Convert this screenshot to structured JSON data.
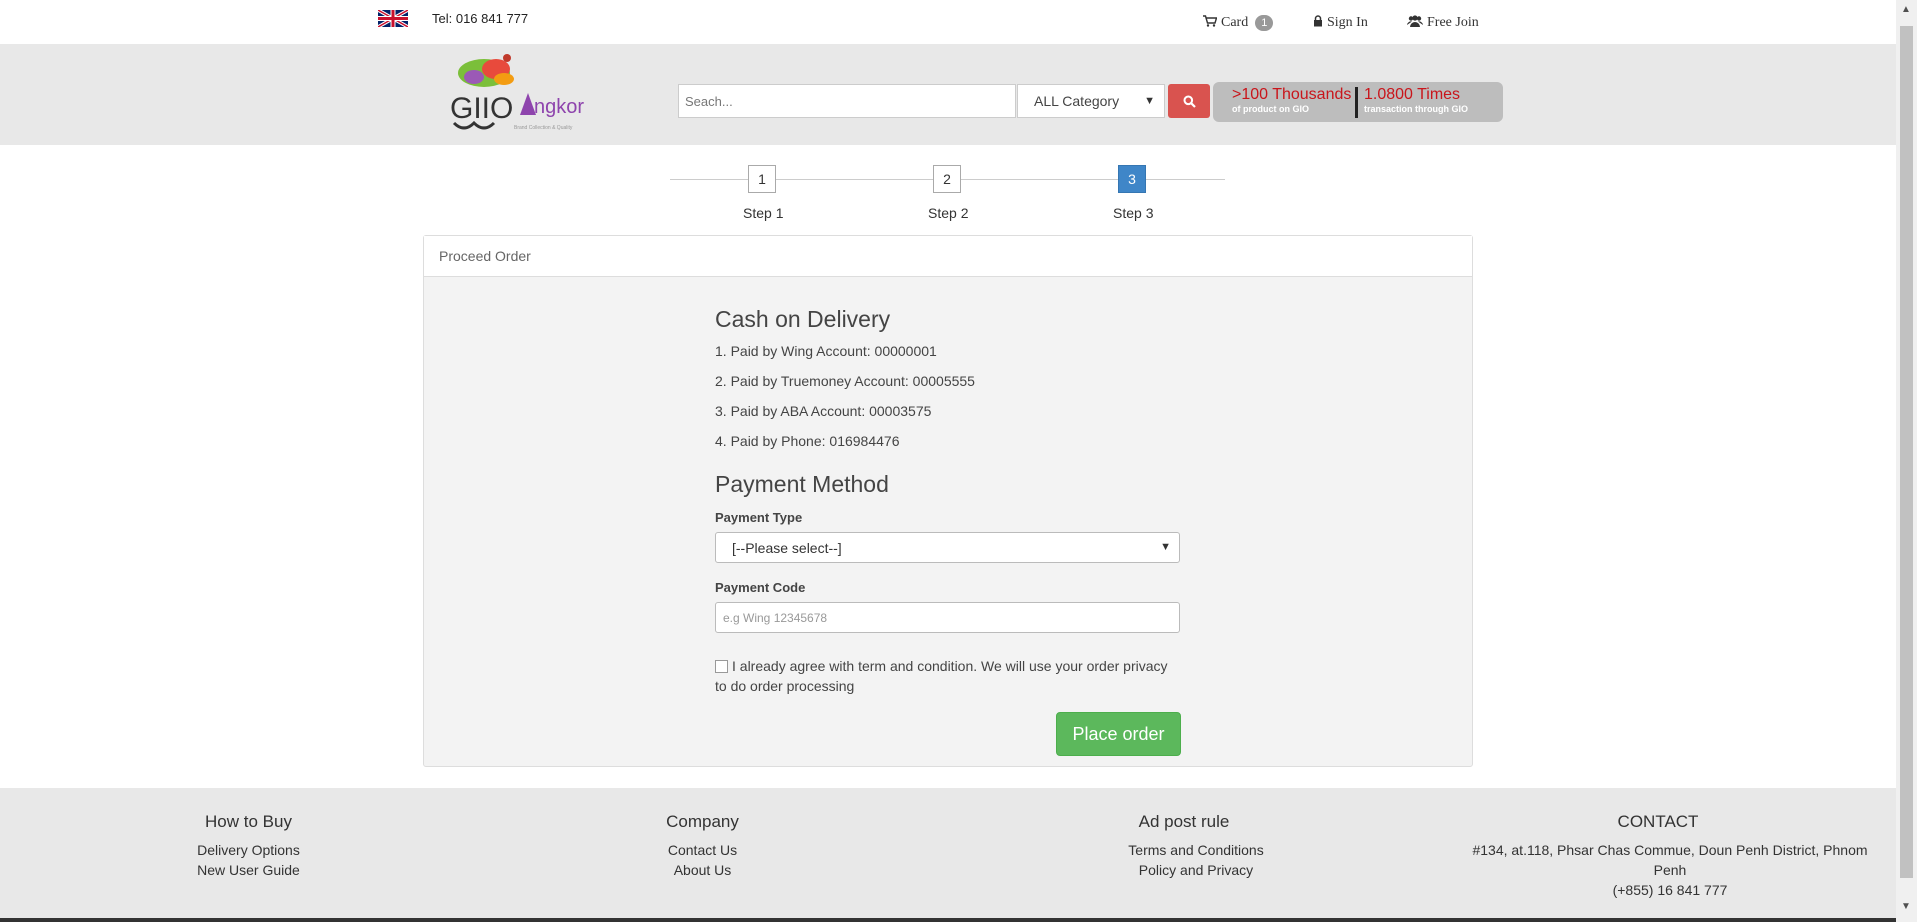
{
  "topbar": {
    "flag_icon": "uk-flag-icon",
    "tel": "Tel: 016 841 777",
    "card_label": "Card",
    "card_count": "1",
    "signin_label": "Sign In",
    "join_label": "Free Join"
  },
  "header": {
    "logo_alt": "GIO Angkor",
    "search_placeholder": "Seach...",
    "category_selected": "ALL Category",
    "promo_main_1": ">100 Thousands",
    "promo_sub_1": "of product on GIO",
    "promo_main_2": "1.0800 Times",
    "promo_sub_2": "transaction through GIO"
  },
  "steps": [
    {
      "number": "1",
      "label": "Step 1",
      "active": false
    },
    {
      "number": "2",
      "label": "Step 2",
      "active": false
    },
    {
      "number": "3",
      "label": "Step 3",
      "active": true
    }
  ],
  "panel": {
    "heading": "Proceed Order",
    "cod_title": "Cash on Delivery",
    "payment_options": [
      "1. Paid by Wing Account: 00000001",
      "2. Paid by Truemoney Account: 00005555",
      "3. Paid by ABA Account: 00003575",
      "4. Paid by Phone: 016984476"
    ],
    "method_title": "Payment Method",
    "type_label": "Payment Type",
    "type_selected": "[--Please select--]",
    "code_label": "Payment Code",
    "code_placeholder": "e.g Wing 12345678",
    "agree_text": "I already agree with term and condition. We will use your order privacy to do order processing",
    "place_order_label": "Place order"
  },
  "footer": {
    "how_to_buy": {
      "title": "How to Buy",
      "links": [
        "Delivery Options",
        "New User Guide"
      ]
    },
    "company": {
      "title": "Company",
      "links": [
        "Contact Us",
        "About Us"
      ]
    },
    "ad_post": {
      "title": "Ad post rule",
      "links": [
        "Terms and Conditions",
        "Policy and Privacy"
      ]
    },
    "contact": {
      "title": "CONTACT",
      "address": "#134, at.118, Phsar Chas Commue, Doun Penh District, Phnom Penh",
      "phone": "(+855) 16 841 777"
    }
  },
  "colors": {
    "primary_step": "#3f86c8",
    "search_button": "#d9534f",
    "place_order": "#5cb85c",
    "promo_text": "#c9151b"
  }
}
